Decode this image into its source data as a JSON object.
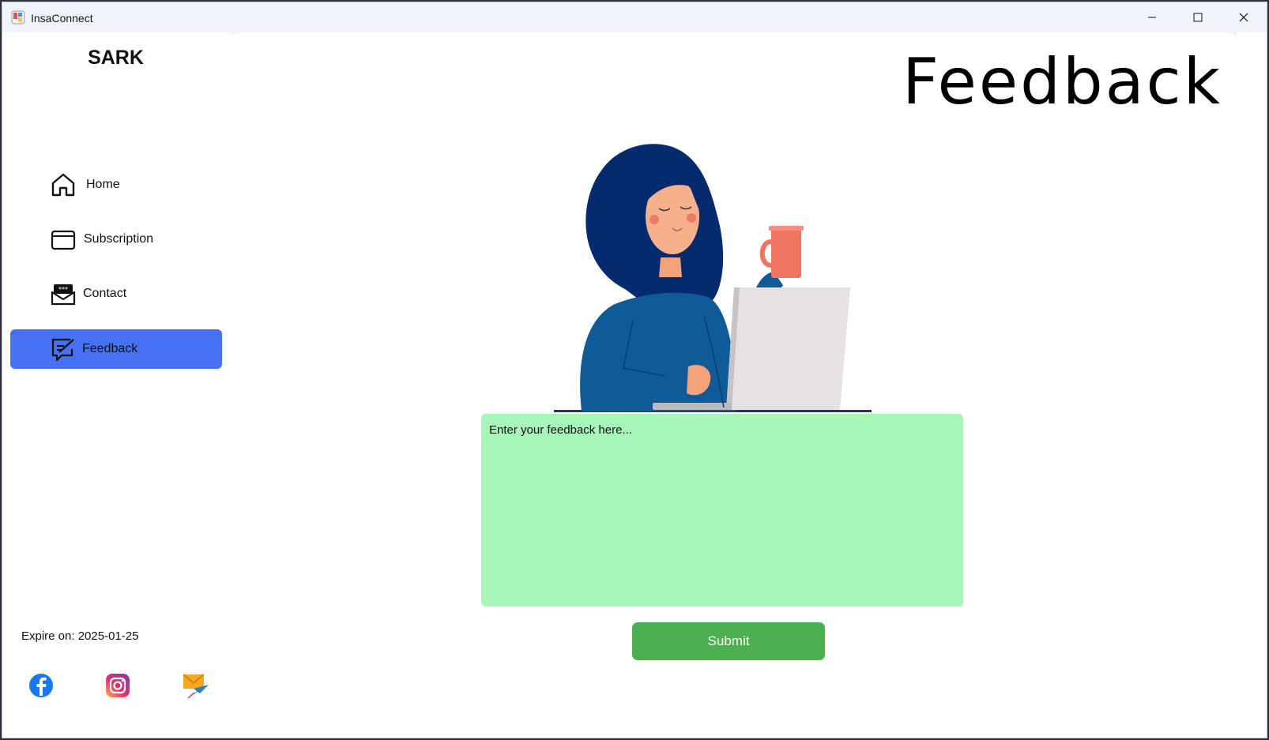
{
  "window": {
    "title": "InsaConnect"
  },
  "sidebar": {
    "brand": "SARK",
    "items": [
      {
        "label": "Home",
        "icon": "home-icon",
        "active": false
      },
      {
        "label": "Subscription",
        "icon": "wallet-icon",
        "active": false
      },
      {
        "label": "Contact",
        "icon": "contact-icon",
        "active": false
      },
      {
        "label": "Feedback",
        "icon": "feedback-icon",
        "active": true
      }
    ],
    "expire_text": "Expire on: 2025-01-25",
    "social": [
      "facebook-icon",
      "instagram-icon",
      "email-icon"
    ]
  },
  "main": {
    "title": "Feedback",
    "feedback_placeholder": "Enter your feedback here...",
    "submit_label": "Submit"
  },
  "colors": {
    "active_nav": "#4571f2",
    "feedback_box": "#a6f5b9",
    "submit_button": "#4caf50"
  }
}
